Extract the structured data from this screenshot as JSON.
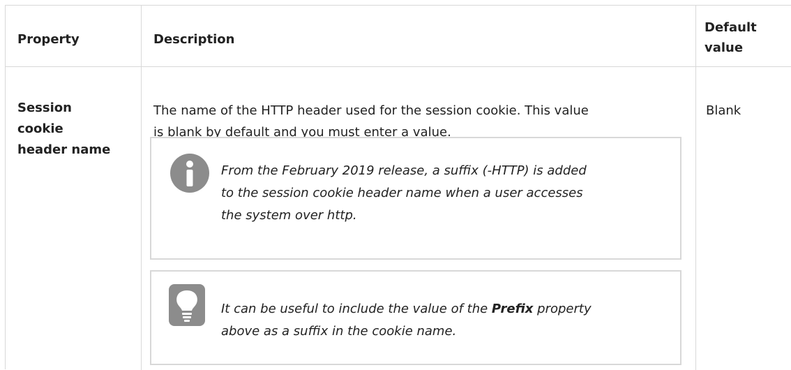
{
  "table": {
    "headers": {
      "property": "Property",
      "description": "Description",
      "default_line1": "Default",
      "default_line2": "value"
    },
    "row": {
      "property_lines": [
        "Session",
        "cookie",
        "header name"
      ],
      "description_lines": [
        "The name of the HTTP header used for the session cookie. This value",
        "is blank by default and you must enter a value."
      ],
      "default_value": "Blank",
      "info_note": {
        "icon": "info-icon",
        "lines": [
          "From the February 2019 release, a suffix (-HTTP) is added",
          "to the session cookie header name when a user accesses",
          "the system over http."
        ]
      },
      "tip_note": {
        "icon": "lightbulb-icon",
        "line1_before": "It can be useful to include the value of the ",
        "line1_bold": "Prefix",
        "line1_after": " property",
        "line2": "above as a suffix in the cookie name."
      }
    }
  }
}
